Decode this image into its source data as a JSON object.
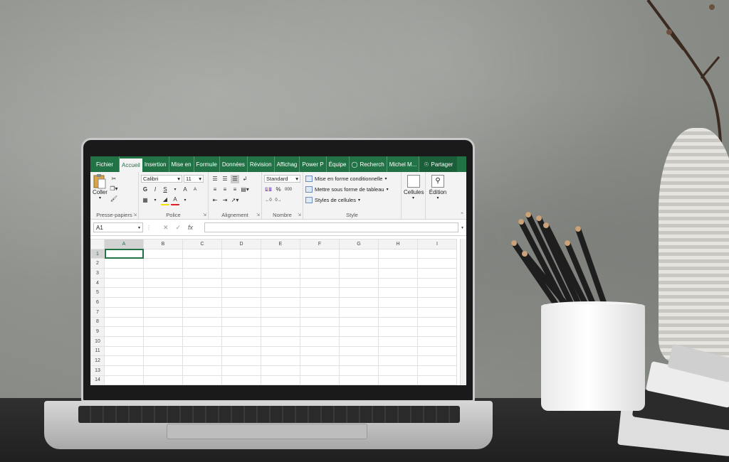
{
  "app": {
    "tabs": [
      "Fichier",
      "Accueil",
      "Insertion",
      "Mise en",
      "Formule",
      "Données",
      "Révision",
      "Affichag",
      "Power P",
      "Équipe"
    ],
    "active_tab": "Accueil",
    "search_label": "Recherch",
    "user_label": "Michel M...",
    "share_label": "Partager"
  },
  "ribbon": {
    "clipboard": {
      "paste_label": "Coller",
      "group_label": "Presse-papiers"
    },
    "font": {
      "font_name": "Calibri",
      "font_size": "11",
      "bold": "G",
      "italic": "I",
      "underline": "S",
      "grow": "A",
      "shrink": "A",
      "font_color": "A",
      "group_label": "Police"
    },
    "alignment": {
      "group_label": "Alignement"
    },
    "number": {
      "format": "Standard",
      "percent": "%",
      "thousands": "000",
      "group_label": "Nombre"
    },
    "styles": {
      "conditional": "Mise en forme conditionnelle",
      "as_table": "Mettre sous forme de tableau",
      "cell_styles": "Styles de cellules",
      "group_label": "Style"
    },
    "cells": {
      "label": "Cellules"
    },
    "editing": {
      "label": "Édition"
    }
  },
  "formula_bar": {
    "name_box": "A1",
    "fx": "fx",
    "value": ""
  },
  "sheet": {
    "columns": [
      "A",
      "B",
      "C",
      "D",
      "E",
      "F",
      "G",
      "H",
      "I"
    ],
    "rows": [
      "1",
      "2",
      "3",
      "4",
      "5",
      "6",
      "7",
      "8",
      "9",
      "10",
      "11",
      "12",
      "13",
      "14"
    ],
    "selected_cell": "A1"
  },
  "colors": {
    "excel_green": "#217346",
    "ribbon_bg": "#f3f3f3"
  }
}
